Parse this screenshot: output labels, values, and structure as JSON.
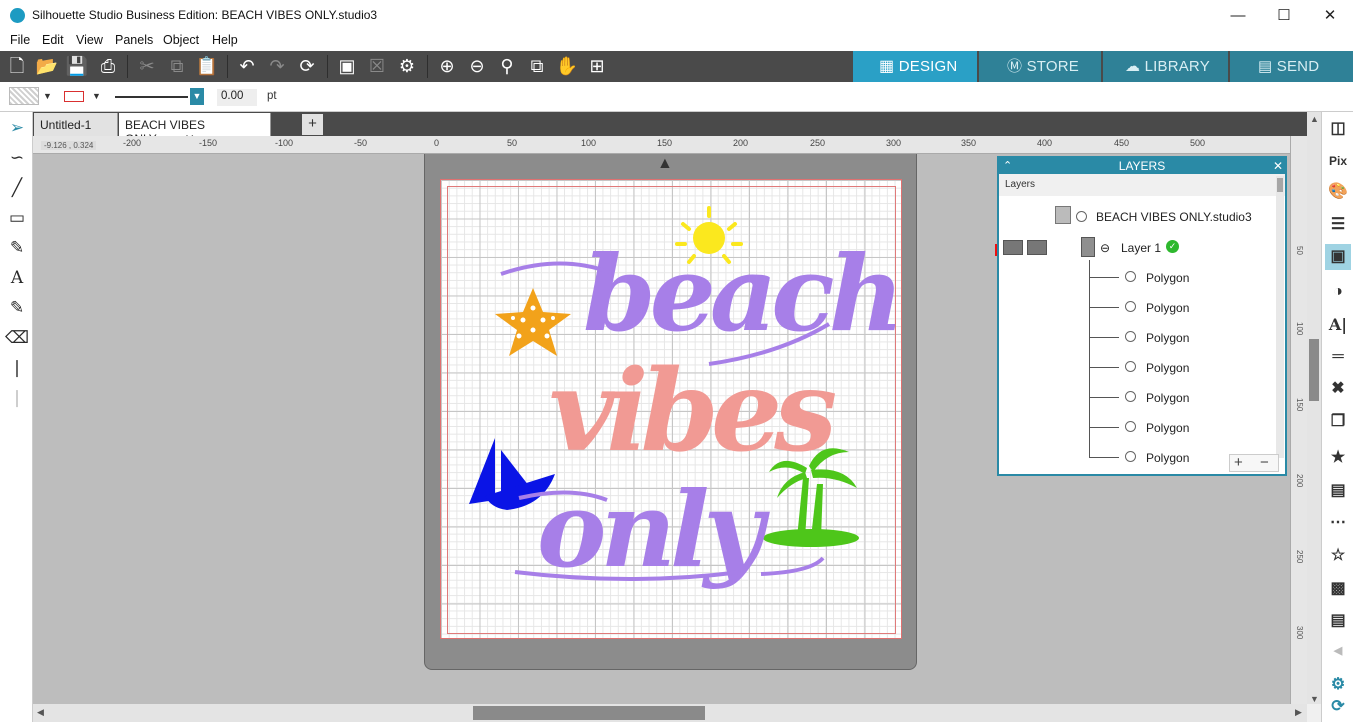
{
  "window": {
    "title": "Silhouette Studio Business Edition: BEACH VIBES ONLY.studio3",
    "minimize": "—",
    "maximize": "☐",
    "close": "✕"
  },
  "menu": [
    "File",
    "Edit",
    "View",
    "Panels",
    "Object",
    "Help"
  ],
  "nav_tabs": {
    "design": "DESIGN",
    "store": "STORE",
    "library": "LIBRARY",
    "send": "SEND"
  },
  "properties": {
    "line_width": "0.00",
    "unit": "pt",
    "line_color": "#d93030"
  },
  "doc_tabs": [
    {
      "label": "Untitled-1",
      "close": "✕"
    },
    {
      "label": "BEACH VIBES ONLY.s...",
      "close": "✕"
    }
  ],
  "new_tab": "+",
  "ruler": {
    "coord": "-9.126 , 0.324",
    "ticks": [
      "-200",
      "-150",
      "-100",
      "-50",
      "0",
      "50",
      "100",
      "150",
      "200",
      "250",
      "300",
      "350",
      "400",
      "450",
      "500"
    ],
    "vticks": [
      "50",
      "100",
      "150",
      "200",
      "250",
      "300"
    ]
  },
  "artwork": {
    "word1": "beach",
    "word2": "vibes",
    "word3": "only",
    "colors": {
      "purple": "#a77fe8",
      "pink": "#f19a94",
      "orange": "#f2a21a",
      "yellow": "#fbe81e",
      "blue": "#0a14e6",
      "green": "#4ec61a"
    }
  },
  "layers": {
    "panel_title": "LAYERS",
    "subheader": "Layers",
    "document": "BEACH VIBES ONLY.studio3",
    "layer": "Layer 1",
    "items": [
      "Polygon",
      "Polygon",
      "Polygon",
      "Polygon",
      "Polygon",
      "Polygon",
      "Polygon"
    ],
    "add": "+",
    "remove": "−"
  },
  "theme": {
    "accent": "#2aa0c6",
    "toolbar": "#4a4a4a",
    "canvas": "#bdbdbd"
  }
}
